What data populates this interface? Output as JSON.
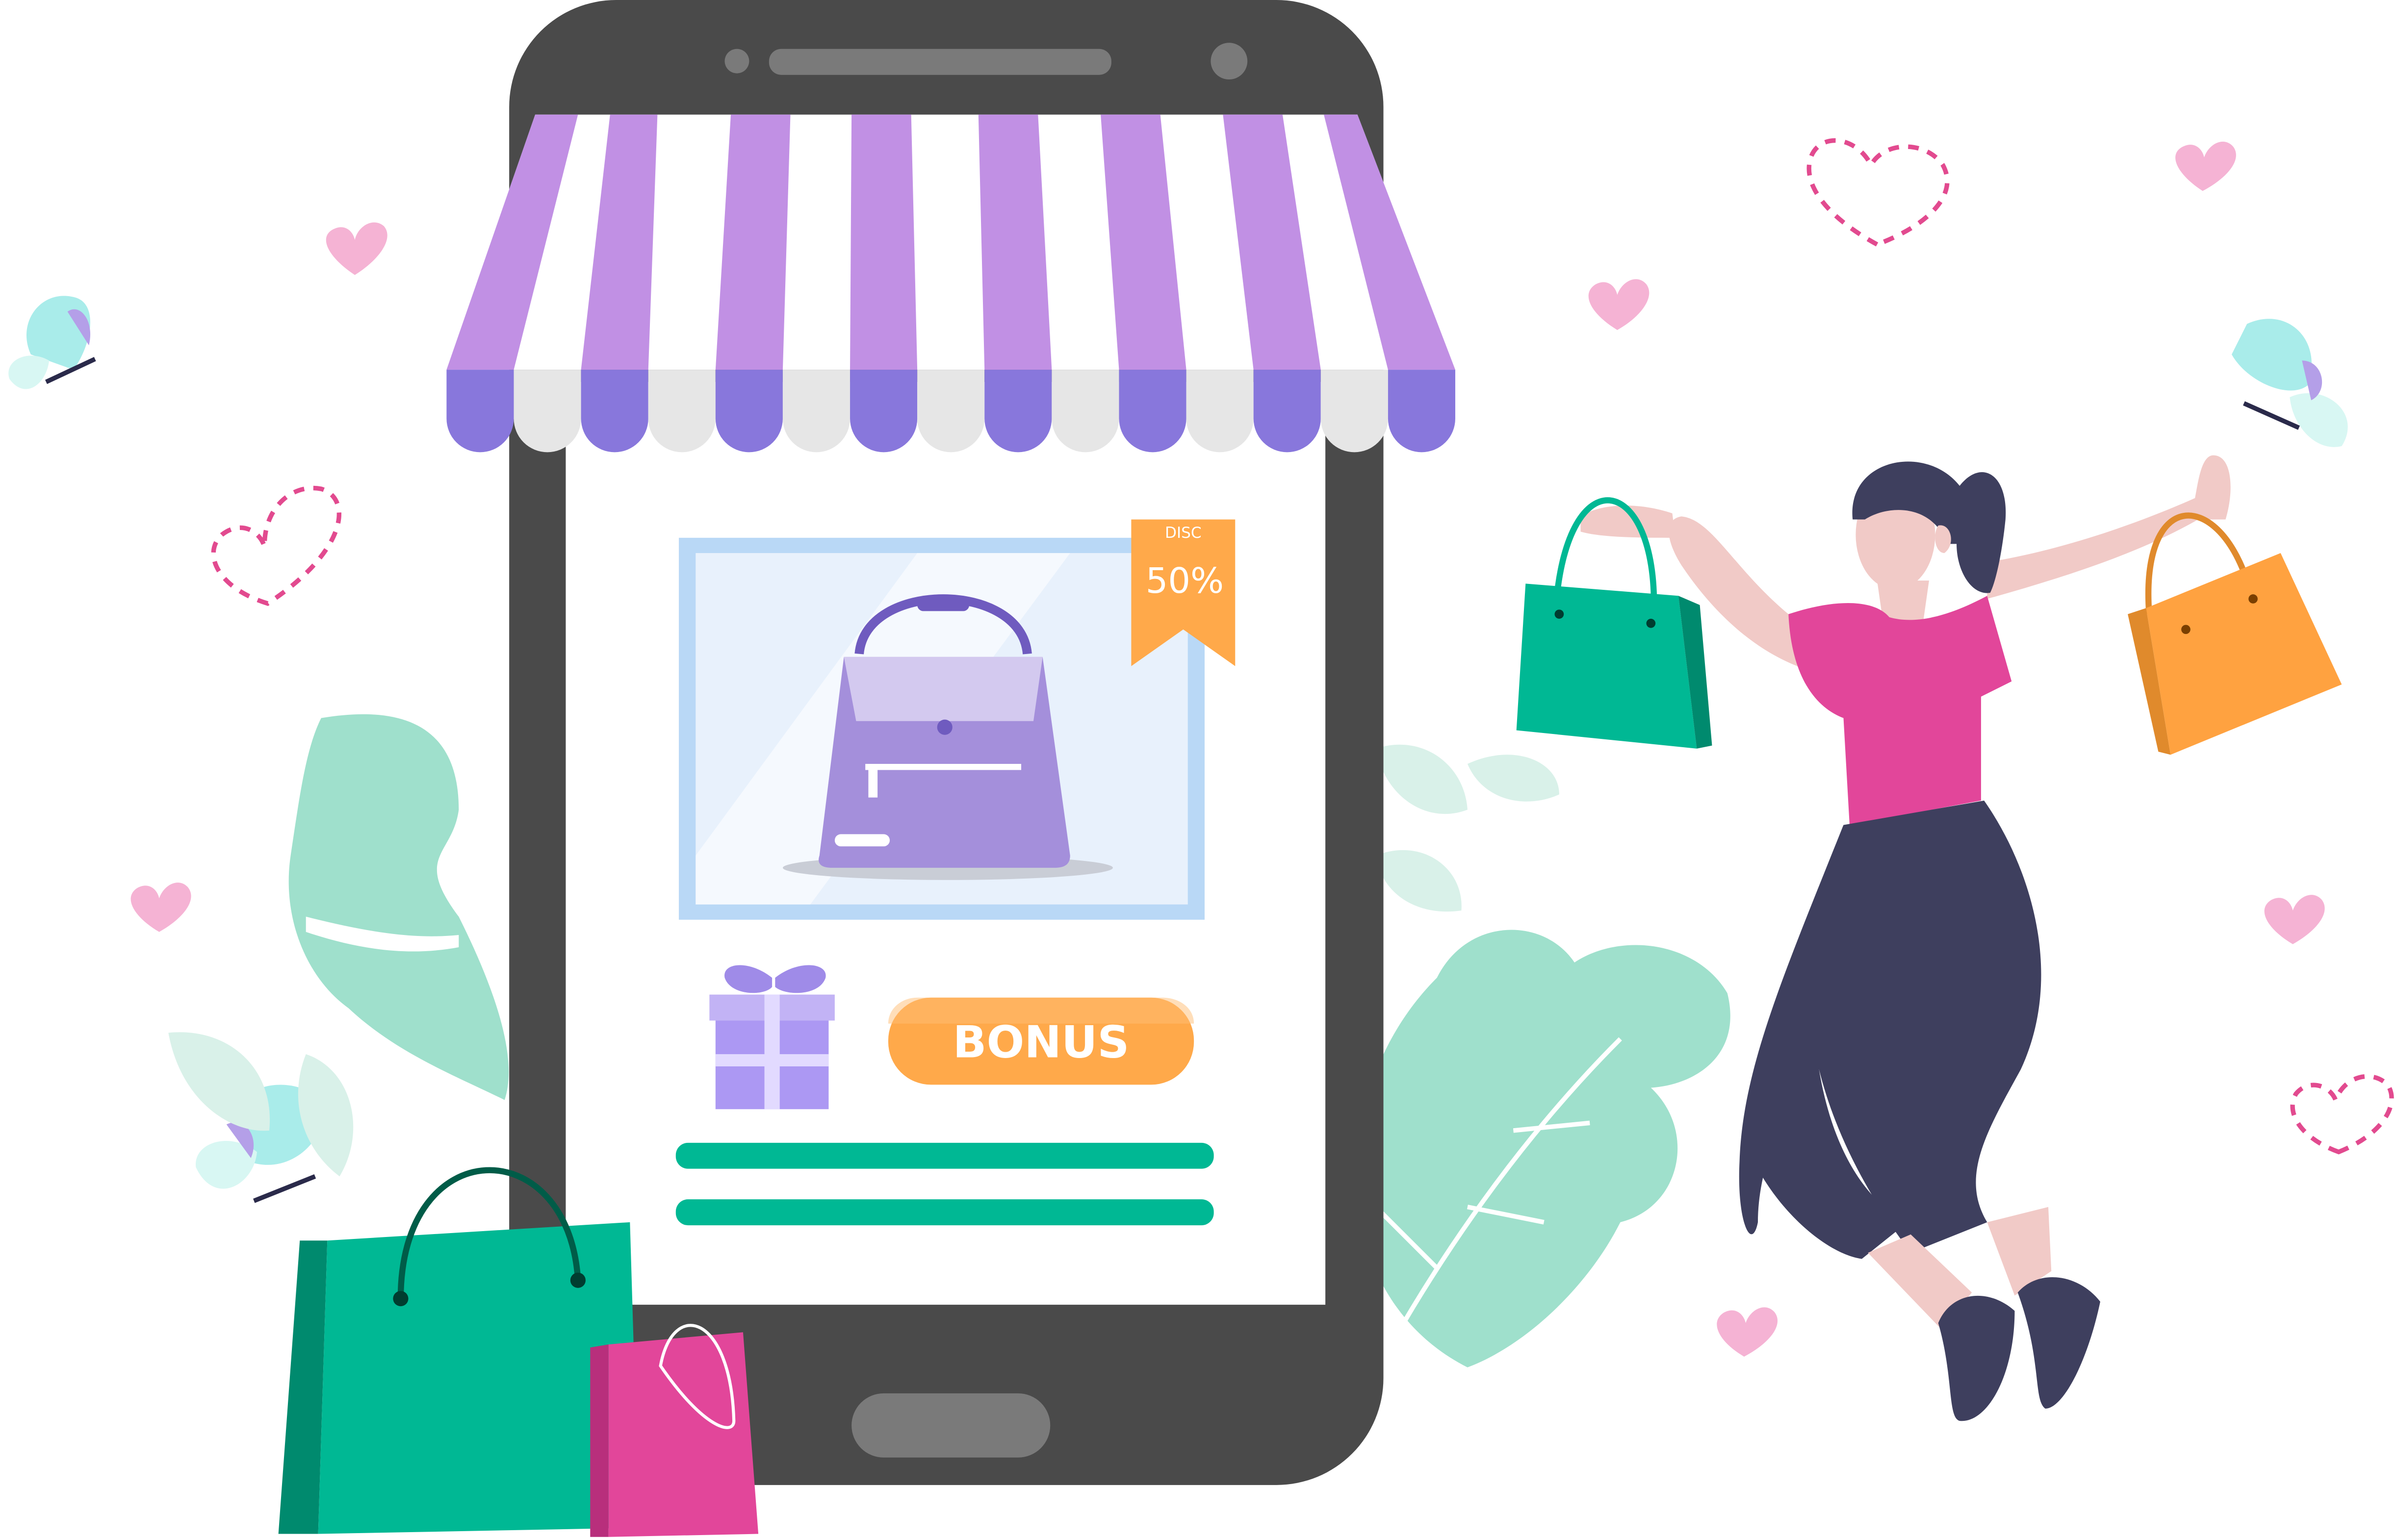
{
  "illustration": {
    "subject": "online-shopping",
    "discount_tag": {
      "top": "DISC",
      "value": "50%"
    },
    "bonus_button": {
      "label": "BONUS"
    }
  },
  "colors": {
    "phone_body": "#4a4a4a",
    "awning_purple": "#c190e4",
    "awning_scallop": "#8877dc",
    "awning_white": "#ffffff",
    "bag_green": "#00b894",
    "bag_green_dark": "#008a6e",
    "bag_orange": "#ffa240",
    "bag_pink": "#e2469a",
    "bonus_orange": "#ffa94a",
    "shirt_pink": "#e2469a",
    "pants_navy": "#3e3f5e",
    "skin": "#f1cac7",
    "leaf_mint": "#9fe0cc",
    "heart_pink": "#f5b3d4",
    "butterfly": "#a9ecea"
  },
  "icons": [
    "heart-icon",
    "dashed-heart-icon",
    "butterfly-icon",
    "gift-icon",
    "handbag-icon",
    "shopping-bag-icon",
    "leaf-icon"
  ]
}
